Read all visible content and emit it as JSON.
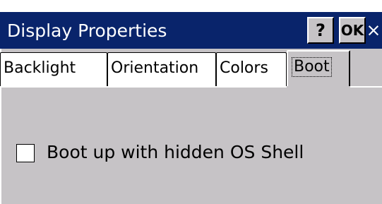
{
  "window": {
    "title": "Display Properties",
    "help_label": "?",
    "ok_label": "OK",
    "close_label": "×"
  },
  "tabs": [
    {
      "label": "Backlight"
    },
    {
      "label": "Orientation"
    },
    {
      "label": "Colors"
    },
    {
      "label": "Boot"
    }
  ],
  "boot": {
    "checkbox_label": "Boot up with hidden OS Shell",
    "checked": false
  },
  "colors": {
    "titlebar": "#09246b",
    "panel": "#c6c3c6"
  }
}
